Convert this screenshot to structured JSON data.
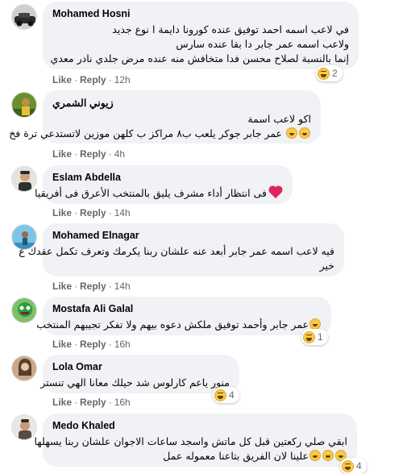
{
  "comments": [
    {
      "name": "Mohamed Hosni",
      "lines": [
        "في لاعب اسمه احمد توفيق عنده كورونا دايمة ا نوع جديد",
        "ولاعب اسمه عمر جابر دا بقا عنده سارس",
        "إنما بالنسبة لصلاح محسن فدا متخافش منه عنده مرض جلدي نادر معدي"
      ],
      "like": "Like",
      "reply": "Reply",
      "time": "12h",
      "reaction_count": "2"
    },
    {
      "name": "زيوني الشمري",
      "lines": [
        "اكو لاعب اسمة",
        "عمر جابر جوكر يلعب ب٨ مراكز ب كلهن موزين لاتستدعي ترة فخ"
      ],
      "like": "Like",
      "reply": "Reply",
      "time": "4h",
      "reaction_count": ""
    },
    {
      "name": "Eslam Abdella",
      "lines": [
        "فى انتظار أداء مشرف يليق بالمنتخب الأعرق فى أفريقيا"
      ],
      "like": "Like",
      "reply": "Reply",
      "time": "14h",
      "reaction_count": ""
    },
    {
      "name": "Mohamed Elnagar",
      "lines": [
        "فيه لاعب اسمه عمر جابر أبعد عنه علشان ربنا يكرمك وتعرف تكمل عقدك ع",
        "خير"
      ],
      "like": "Like",
      "reply": "Reply",
      "time": "14h",
      "reaction_count": ""
    },
    {
      "name": "Mostafa Ali Galal",
      "lines": [
        "عمر جابر وأحمد توفيق ملكش دعوه بيهم ولا تفكر تجيبهم المنتخب"
      ],
      "like": "Like",
      "reply": "Reply",
      "time": "16h",
      "reaction_count": "1"
    },
    {
      "name": "Lola Omar",
      "lines": [
        "منور ياعم كارلوس شد حيلك معانا الهي تنستر"
      ],
      "like": "Like",
      "reply": "Reply",
      "time": "16h",
      "reaction_count": "4"
    },
    {
      "name": "Medo Khaled",
      "lines": [
        "ابقي صلي ركعتين قبل كل ماتش واسجد ساعات الاجوان علشان ربنا يسهلها",
        "علينا لان الفريق بتاعنا معموله عمل"
      ],
      "like": "Like",
      "reply": "Reply",
      "time": "16h",
      "reaction_count": "4"
    }
  ]
}
